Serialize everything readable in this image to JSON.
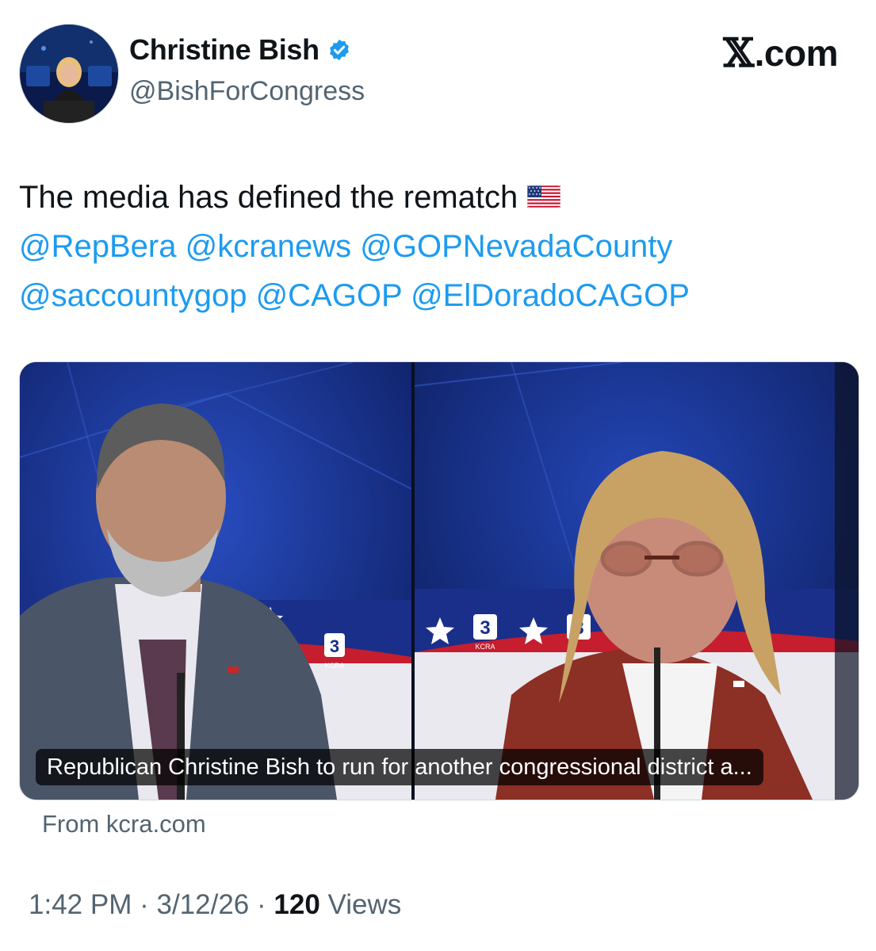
{
  "author": {
    "display_name": "Christine Bish",
    "handle": "@BishForCongress",
    "verified_icon": "verified-badge-icon",
    "avatar_icon": "profile-photo"
  },
  "brand": {
    "logo": "𝕏",
    "label": ".com"
  },
  "tweet": {
    "text": "The media has defined the rematch",
    "emoji_icon": "us-flag-icon",
    "mentions_line1": [
      "@RepBera",
      "@kcranews",
      "@GOPNevadaCounty"
    ],
    "mentions_line2": [
      "@saccountygop",
      "@CAGOP",
      "@ElDoradoCAGOP"
    ]
  },
  "media": {
    "caption": "Republican Christine Bish to run for another congressional district a...",
    "source": "From kcra.com",
    "station_logo": "3",
    "station_name": "KCRA"
  },
  "meta": {
    "time": "1:42 PM",
    "separator": "·",
    "date": "3/12/26",
    "views_count": "120",
    "views_label": "Views"
  },
  "colors": {
    "link": "#1d9bf0",
    "secondary_text": "#536471",
    "verified": "#1d9bf0"
  }
}
